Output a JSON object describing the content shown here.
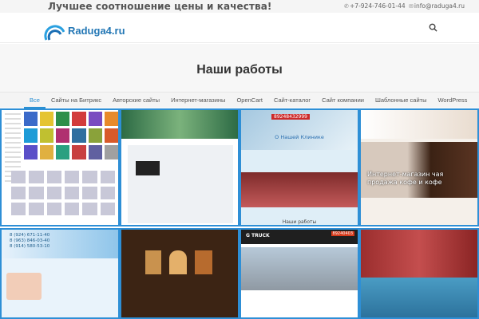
{
  "topbar": {
    "slogan": "Лучшее соотношение цены и качества!",
    "phone": "+7-924-746-01-44",
    "email": "info@raduga4.ru"
  },
  "header": {
    "logo_text": "Raduga4.ru",
    "brand_color": "#2377b5"
  },
  "page": {
    "title": "Наши работы"
  },
  "filters": {
    "active_color": "#2a8fd2",
    "items": [
      {
        "label": "Все",
        "active": true
      },
      {
        "label": "Сайты на Битрикс",
        "active": false
      },
      {
        "label": "Авторские сайты",
        "active": false
      },
      {
        "label": "Интернет-магазины",
        "active": false
      },
      {
        "label": "OpenCart",
        "active": false
      },
      {
        "label": "Сайт-каталог",
        "active": false
      },
      {
        "label": "Сайт компании",
        "active": false
      },
      {
        "label": "Шаблонные сайты",
        "active": false
      },
      {
        "label": "WordPress",
        "active": false
      }
    ]
  },
  "portfolio": {
    "clinic_phone": "89248432999",
    "clinic_about": "О Нашей Клинике",
    "clinic_works": "Наши работы",
    "coffee_headline": "Интернет-магазин чая",
    "coffee_sub": "продажа кофе и кофе",
    "med_phone_1": "8 (924) 671-11-40",
    "med_phone_2": "8 (963) 846-03-40",
    "med_phone_3": "8 (914) 580-53-10",
    "truck_title": "G TRUCK",
    "truck_phone": "89240403"
  }
}
